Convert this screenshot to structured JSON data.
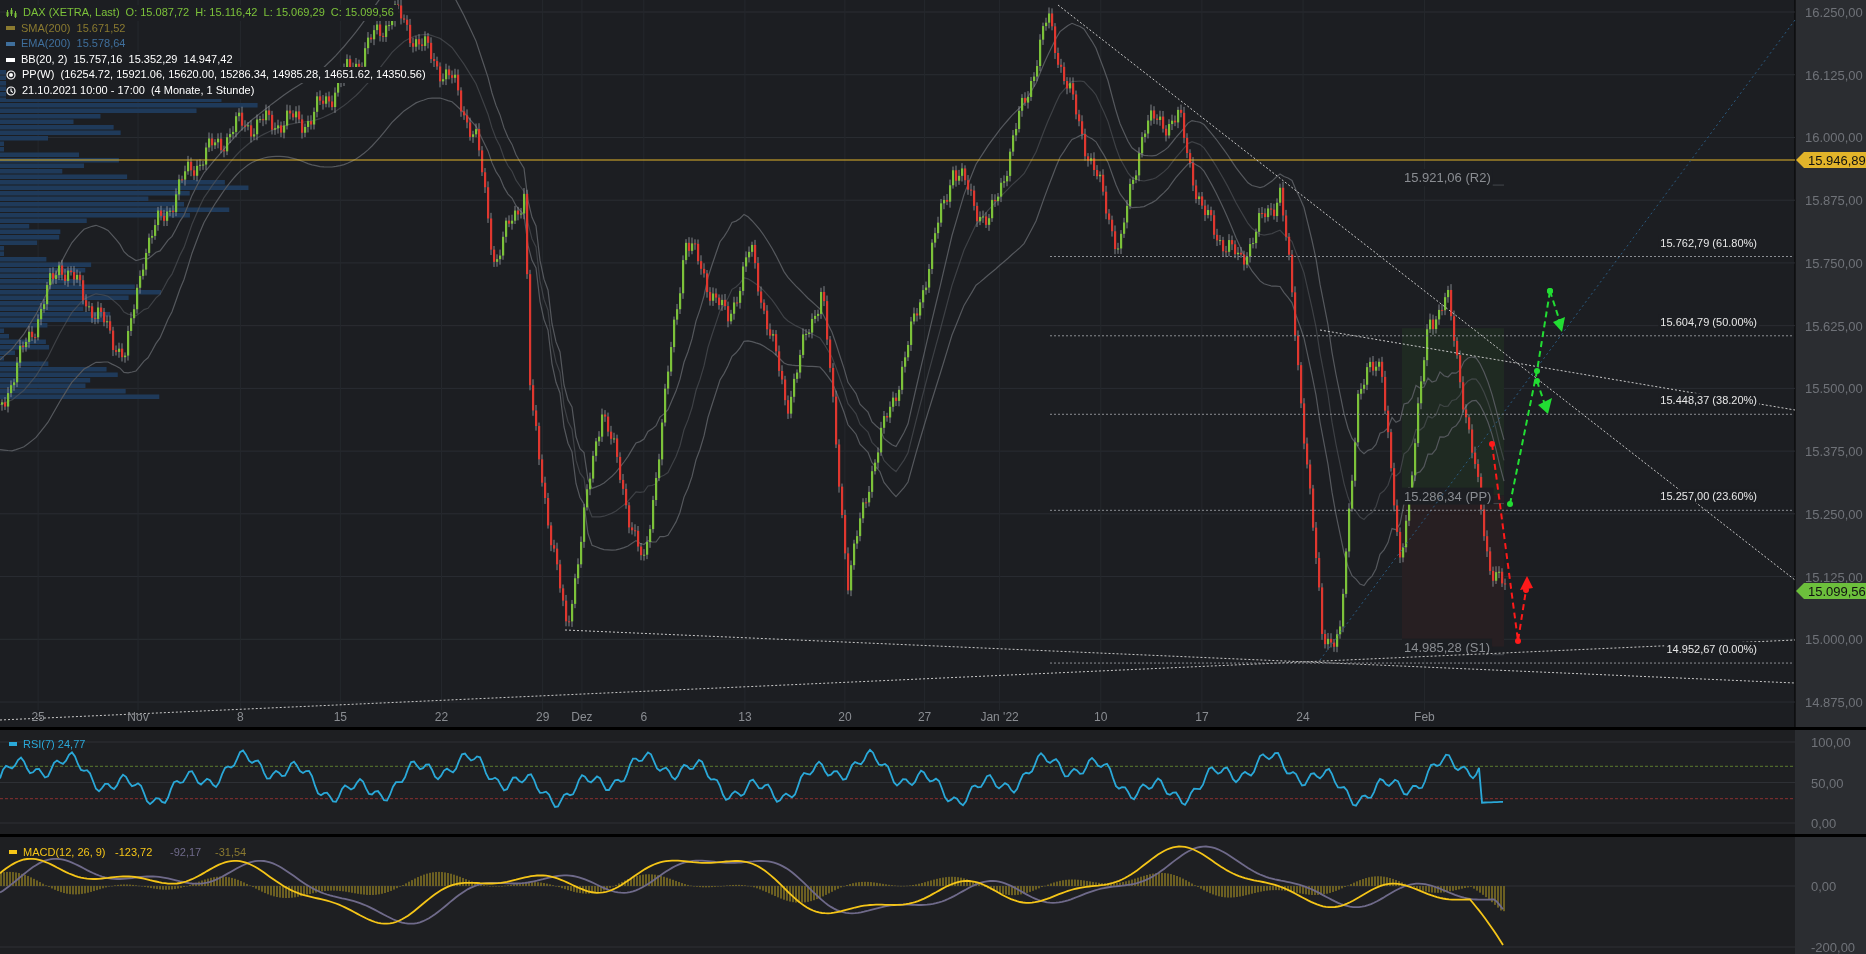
{
  "legend": {
    "title": "DAX (XETRA, Last)",
    "ohlc": "O: 15.087,72  H: 15.116,42  L: 15.069,29  C: 15.099,56",
    "indicators": [
      {
        "label": "SMA(200)",
        "value": "15.671,52",
        "color": "#8a7a30"
      },
      {
        "label": "EMA(200)",
        "value": "15.578,64",
        "color": "#3f6f9c"
      },
      {
        "label": "BB(20, 2)",
        "value": "15.757,16  15.352,29  14.947,42",
        "color": "#ffffff"
      }
    ],
    "pivot": "PP(W)  (16254.72, 15921.06, 15620.00, 15286.34, 14985.28, 14651.62, 14350.56)",
    "period": {
      "range": "21.10.2021 10:00 - 17:00",
      "span": "(4 Monate, 1 Stunde)"
    }
  },
  "price_axis": {
    "ticks": [
      "16.250,00",
      "16.125,00",
      "16.000,00",
      "15.875,00",
      "15.750,00",
      "15.625,00",
      "15.500,00",
      "15.375,00",
      "15.250,00",
      "15.125,00",
      "15.000,00",
      "14.875,00"
    ],
    "markers": [
      {
        "value": "15.946,89",
        "color": "#e2b42a"
      },
      {
        "value": "15.099,56",
        "color": "#6cbf3c"
      }
    ]
  },
  "fib_levels": [
    "15.762,79 (61.80%)",
    "15.604,79 (50.00%)",
    "15.448,37 (38.20%)",
    "15.257,00 (23.60%)",
    "14.952,67 (0.00%)"
  ],
  "pivot_labels": [
    "15.921,06 (R2)",
    "15.286,34 (PP)",
    "14.985,28 (S1)"
  ],
  "date_axis": [
    "25",
    "Nov",
    "8",
    "15",
    "22",
    "29",
    "Dez",
    "6",
    "13",
    "20",
    "27",
    "Jan '22",
    "10",
    "17",
    "24",
    "Feb"
  ],
  "rsi": {
    "label": "RSI(7)",
    "value": "24,77",
    "ticks": [
      "100,00",
      "50,00",
      "0,00"
    ]
  },
  "macd": {
    "label": "MACD(12, 26, 9)",
    "values": [
      {
        "text": "-123,72",
        "color": "#f5c518"
      },
      {
        "text": "-92,17",
        "color": "#6f6a8a"
      },
      {
        "text": "-31,54",
        "color": "#8a7a30"
      }
    ],
    "ticks": [
      "0,00",
      "-200,00"
    ]
  }
}
